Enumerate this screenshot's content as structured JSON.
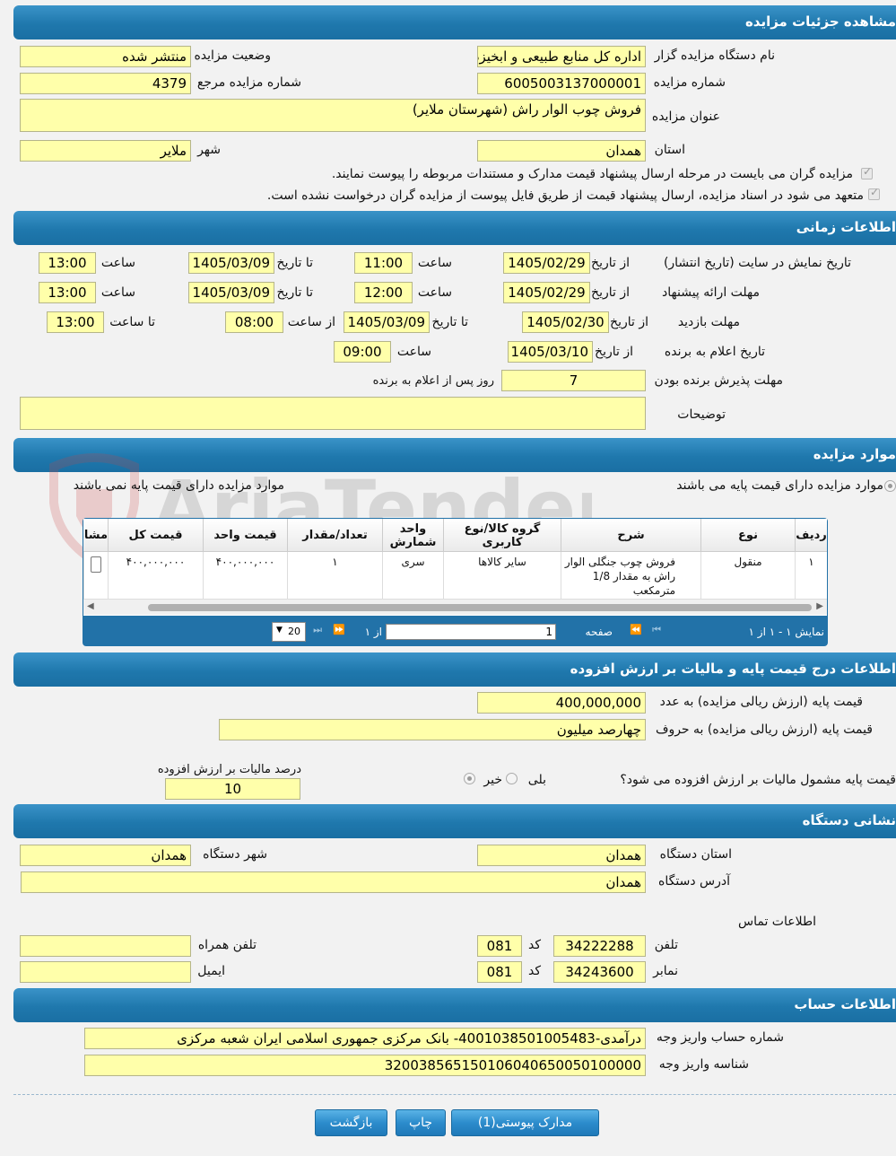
{
  "sections": {
    "details": "مشاهده جزئیات مزایده",
    "time": "اطلاعات زمانی",
    "items": "موارد مزایده",
    "price": "اطلاعات درج قیمت پایه و مالیات بر ارزش افزوده",
    "address": "نشانی دستگاه",
    "account": "اطلاعات حساب"
  },
  "details": {
    "org_label": "نام دستگاه مزایده گزار",
    "org_value": "اداره کل منابع طبیعی و ابخیزداری استان همدان",
    "status_label": "وضعیت مزایده",
    "status_value": "منتشر شده",
    "number_label": "شماره مزایده",
    "number_value": "6005003137000001",
    "ref_label": "شماره مزایده مرجع",
    "ref_value": "4379",
    "title_label": "عنوان مزایده",
    "title_value": "فروش چوب  الوار راش (شهرستان ملایر)",
    "province_label": "استان",
    "province_value": "همدان",
    "city_label": "شهر",
    "city_value": "ملایر",
    "check1": "مزایده گران می بایست در مرحله ارسال پیشنهاد قیمت مدارک و مستندات مربوطه را پیوست نمایند.",
    "check2": "متعهد می شود در اسناد مزایده، ارسال پیشنهاد قیمت از طریق فایل پیوست از مزایده گران درخواست نشده است."
  },
  "time": {
    "display_label": "تاریخ نمایش در سایت (تاریخ انتشار)",
    "from_date": "از تاریخ",
    "to_date": "تا تاریخ",
    "hour": "ساعت",
    "display_from": "1405/02/29",
    "display_from_time": "11:00",
    "display_to": "1405/03/09",
    "display_to_time": "13:00",
    "offer_label": "مهلت ارائه پیشنهاد",
    "offer_from": "1405/02/29",
    "offer_from_time": "12:00",
    "offer_to": "1405/03/09",
    "offer_to_time": "13:00",
    "visit_label": "مهلت بازدید",
    "visit_from": "1405/02/30",
    "visit_to": "1405/03/09",
    "from_hour": "از ساعت",
    "to_hour": "تا ساعت",
    "visit_from_time": "08:00",
    "visit_to_time": "13:00",
    "announce_label": "تاریخ اعلام به برنده",
    "announce_date": "1405/03/10",
    "announce_time": "09:00",
    "accept_label": "مهلت پذیرش برنده بودن",
    "accept_value": "7",
    "accept_suffix": "روز پس از اعلام به برنده",
    "notes_label": "توضیحات",
    "notes_value": ""
  },
  "items": {
    "opt_with": "موارد مزایده دارای قیمت پایه می باشند",
    "opt_without": "موارد مزایده دارای قیمت پایه نمی باشند",
    "columns": [
      "ردیف",
      "نوع",
      "شرح",
      "گروه کالا/نوع کاربری",
      "واحد شمارش",
      "تعداد/مقدار",
      "قیمت واحد",
      "قیمت کل",
      "مشاهده"
    ],
    "row": {
      "idx": "۱",
      "type": "منقول",
      "desc": "فروش چوب جنگلی الوار راش به مقدار 1/8 مترمکعب",
      "group": "سایر کالاها",
      "unit": "سری",
      "qty": "۱",
      "unit_price": "۴۰۰,۰۰۰,۰۰۰",
      "total": "۴۰۰,۰۰۰,۰۰۰"
    },
    "pager": {
      "showing": "نمایش ۱ - ۱ از ۱",
      "page_label": "صفحه",
      "page_value": "1",
      "of_label": "از ۱",
      "page_size": "20"
    }
  },
  "price": {
    "num_label": "قیمت پایه (ارزش ریالی مزایده) به عدد",
    "num_value": "400,000,000",
    "words_label": "قیمت پایه (ارزش ریالی مزایده) به حروف",
    "words_value": "چهارصد میلیون",
    "vat_q": "قیمت پایه مشمول مالیات بر ارزش افزوده می شود؟",
    "yes": "بلی",
    "no": "خیر",
    "vat_pct_label": "درصد مالیات بر ارزش افزوده",
    "vat_pct_value": "10"
  },
  "address": {
    "province_label": "استان دستگاه",
    "province_value": "همدان",
    "city_label": "شهر دستگاه",
    "city_value": "همدان",
    "addr_label": "آدرس دستگاه",
    "addr_value": "همدان",
    "contact_label": "اطلاعات تماس",
    "phone_label": "تلفن",
    "phone_value": "34222288",
    "code_label": "کد",
    "phone_code": "081",
    "mobile_label": "تلفن همراه",
    "mobile_value": "",
    "fax_label": "نمابر",
    "fax_value": "34243600",
    "fax_code": "081",
    "email_label": "ایمیل",
    "email_value": ""
  },
  "account": {
    "acc_label": "شماره حساب واریز وجه",
    "acc_value": "درآمدی-4001038501005483- بانک مرکزی جمهوری اسلامی ایران شعبه مرکزی",
    "id_label": "شناسه واریز وجه",
    "id_value": "320038565150106040650050100000"
  },
  "buttons": {
    "docs": "مدارک پیوستی(1)",
    "print": "چاپ",
    "back": "بازگشت"
  },
  "watermark": "AriaTender.neT",
  "colors": {
    "header": "#1f78ad",
    "field": "#ffffaa",
    "grid": "#2272a8"
  }
}
